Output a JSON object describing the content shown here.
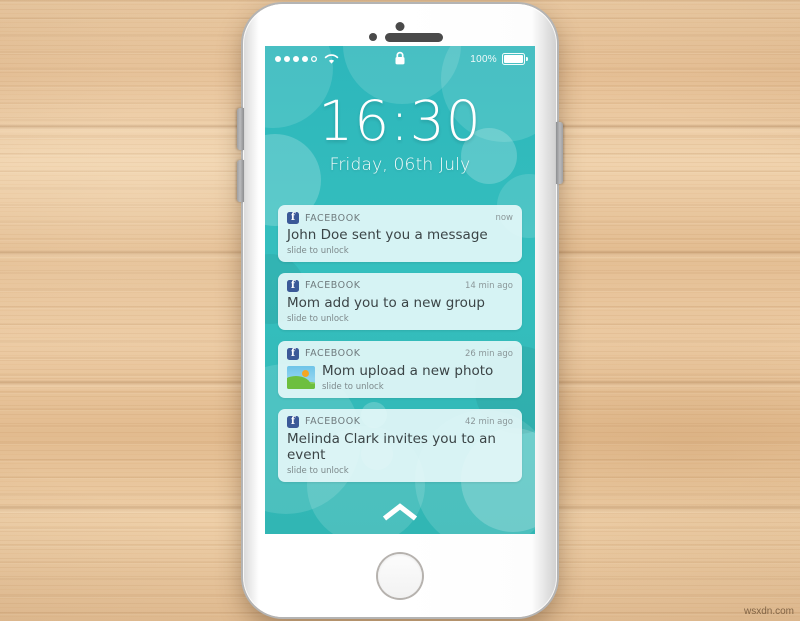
{
  "scene": {
    "background": "wood-desk",
    "wood_color": "#e8c49a",
    "watermark": "wsxdn.com"
  },
  "phone": {
    "body_color": "#ffffff",
    "hardware": [
      {
        "name": "front-camera",
        "label": "Front camera"
      },
      {
        "name": "proximity-sensor",
        "label": "Proximity sensor"
      },
      {
        "name": "earpiece-speaker",
        "label": "Earpiece speaker"
      },
      {
        "name": "volume-up-button",
        "label": "Volume up"
      },
      {
        "name": "volume-down-button",
        "label": "Volume down"
      },
      {
        "name": "power-button",
        "label": "Power"
      },
      {
        "name": "home-button",
        "label": "Home"
      }
    ]
  },
  "screen": {
    "wallpaper_color": "#31b9bb",
    "accent_color": "#3b5998",
    "card_color": "#e8f8f9"
  },
  "status_bar": {
    "signal_dots_filled": 4,
    "signal_dots_total": 5,
    "wifi": "wifi-icon",
    "lock": "lock-icon",
    "battery_percent": "100%",
    "battery_level": 100
  },
  "lock_screen": {
    "time": "16:30",
    "date": "Friday, 06th July",
    "unlock_hint_icon": "chevron-up-icon"
  },
  "notifications": [
    {
      "app": "FACEBOOK",
      "time": "now",
      "message": "John Doe sent you a message",
      "hint": "slide to unlock",
      "has_photo": false
    },
    {
      "app": "FACEBOOK",
      "time": "14 min ago",
      "message": "Mom add you to a new group",
      "hint": "slide to unlock",
      "has_photo": false
    },
    {
      "app": "FACEBOOK",
      "time": "26 min ago",
      "message": "Mom upload a new photo",
      "hint": "slide to unlock",
      "has_photo": true
    },
    {
      "app": "FACEBOOK",
      "time": "42 min ago",
      "message": "Melinda Clark invites you to an event",
      "hint": "slide to unlock",
      "has_photo": false
    }
  ]
}
